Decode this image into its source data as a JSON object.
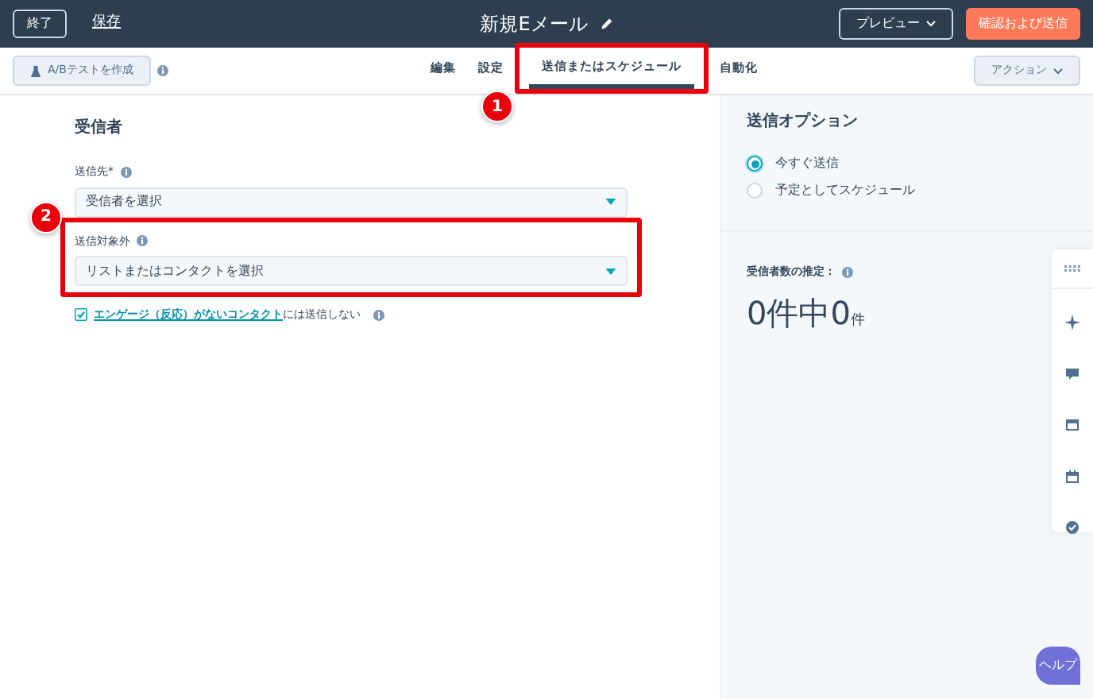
{
  "header": {
    "exit_button": "終了",
    "save_link": "保存",
    "title": "新規Eメール",
    "preview_button": "プレビュー",
    "send_button": "確認および送信"
  },
  "toolbar": {
    "ab_test_button": "A/Bテストを作成",
    "actions_button": "アクション"
  },
  "tabs": [
    {
      "label": "編集",
      "selected": false
    },
    {
      "label": "設定",
      "selected": false
    },
    {
      "label": "送信またはスケジュール",
      "selected": true
    },
    {
      "label": "自動化",
      "selected": false
    }
  ],
  "recipients": {
    "heading": "受信者",
    "fields": [
      {
        "label": "送信先*",
        "value": "受信者を選択"
      },
      {
        "label": "送信対象外",
        "value": "リストまたはコンタクトを選択"
      }
    ],
    "checkbox": {
      "link": "エンゲージ（反応）がないコンタクト",
      "text": "には送信しない",
      "checked": true
    }
  },
  "send_options": {
    "heading": "送信オプション",
    "options": [
      {
        "label": "今すぐ送信",
        "selected": true
      },
      {
        "label": "予定としてスケジュール",
        "selected": false
      }
    ]
  },
  "estimate": {
    "label": "受信者数の推定：",
    "value": "0件中0",
    "unit": "件"
  },
  "help_button": "ヘルプ",
  "callouts": [
    {
      "number": "1"
    },
    {
      "number": "2"
    }
  ]
}
